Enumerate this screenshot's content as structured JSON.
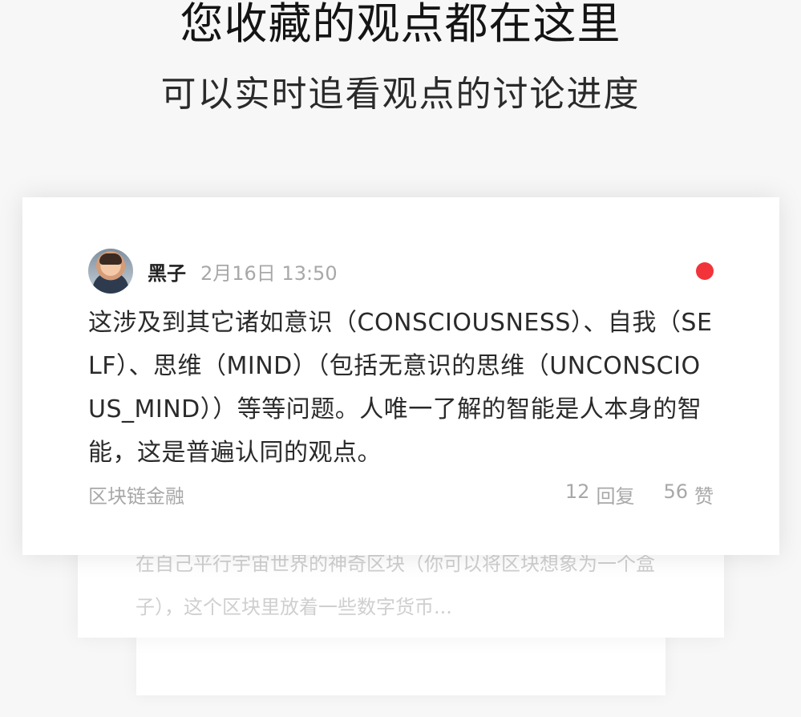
{
  "header": {
    "title": "您收藏的观点都在这里",
    "subtitle": "可以实时追看观点的讨论进度"
  },
  "post": {
    "author": "黑子",
    "time": "2月16日 13:50",
    "body": "这涉及到其它诸如意识（CONSCIOUSNESS）、自我（SELF）、思维（MIND）（包括无意识的思维（UNCONSCIOUS_MIND））等等问题。人唯一了解的智能是人本身的智能，这是普遍认同的观点。",
    "topic": "区块链金融",
    "reply_count": "12",
    "reply_label": "回复",
    "like_count": "56",
    "like_label": "赞",
    "unread_color": "#f2333a"
  },
  "back_card": {
    "text": "在自己平行宇宙世界的神奇区块（你可以将区块想象为一个盒子），这个区块里放着一些数字货币..."
  },
  "icons": {
    "unread": "red-dot-icon",
    "avatar": "user-avatar"
  }
}
